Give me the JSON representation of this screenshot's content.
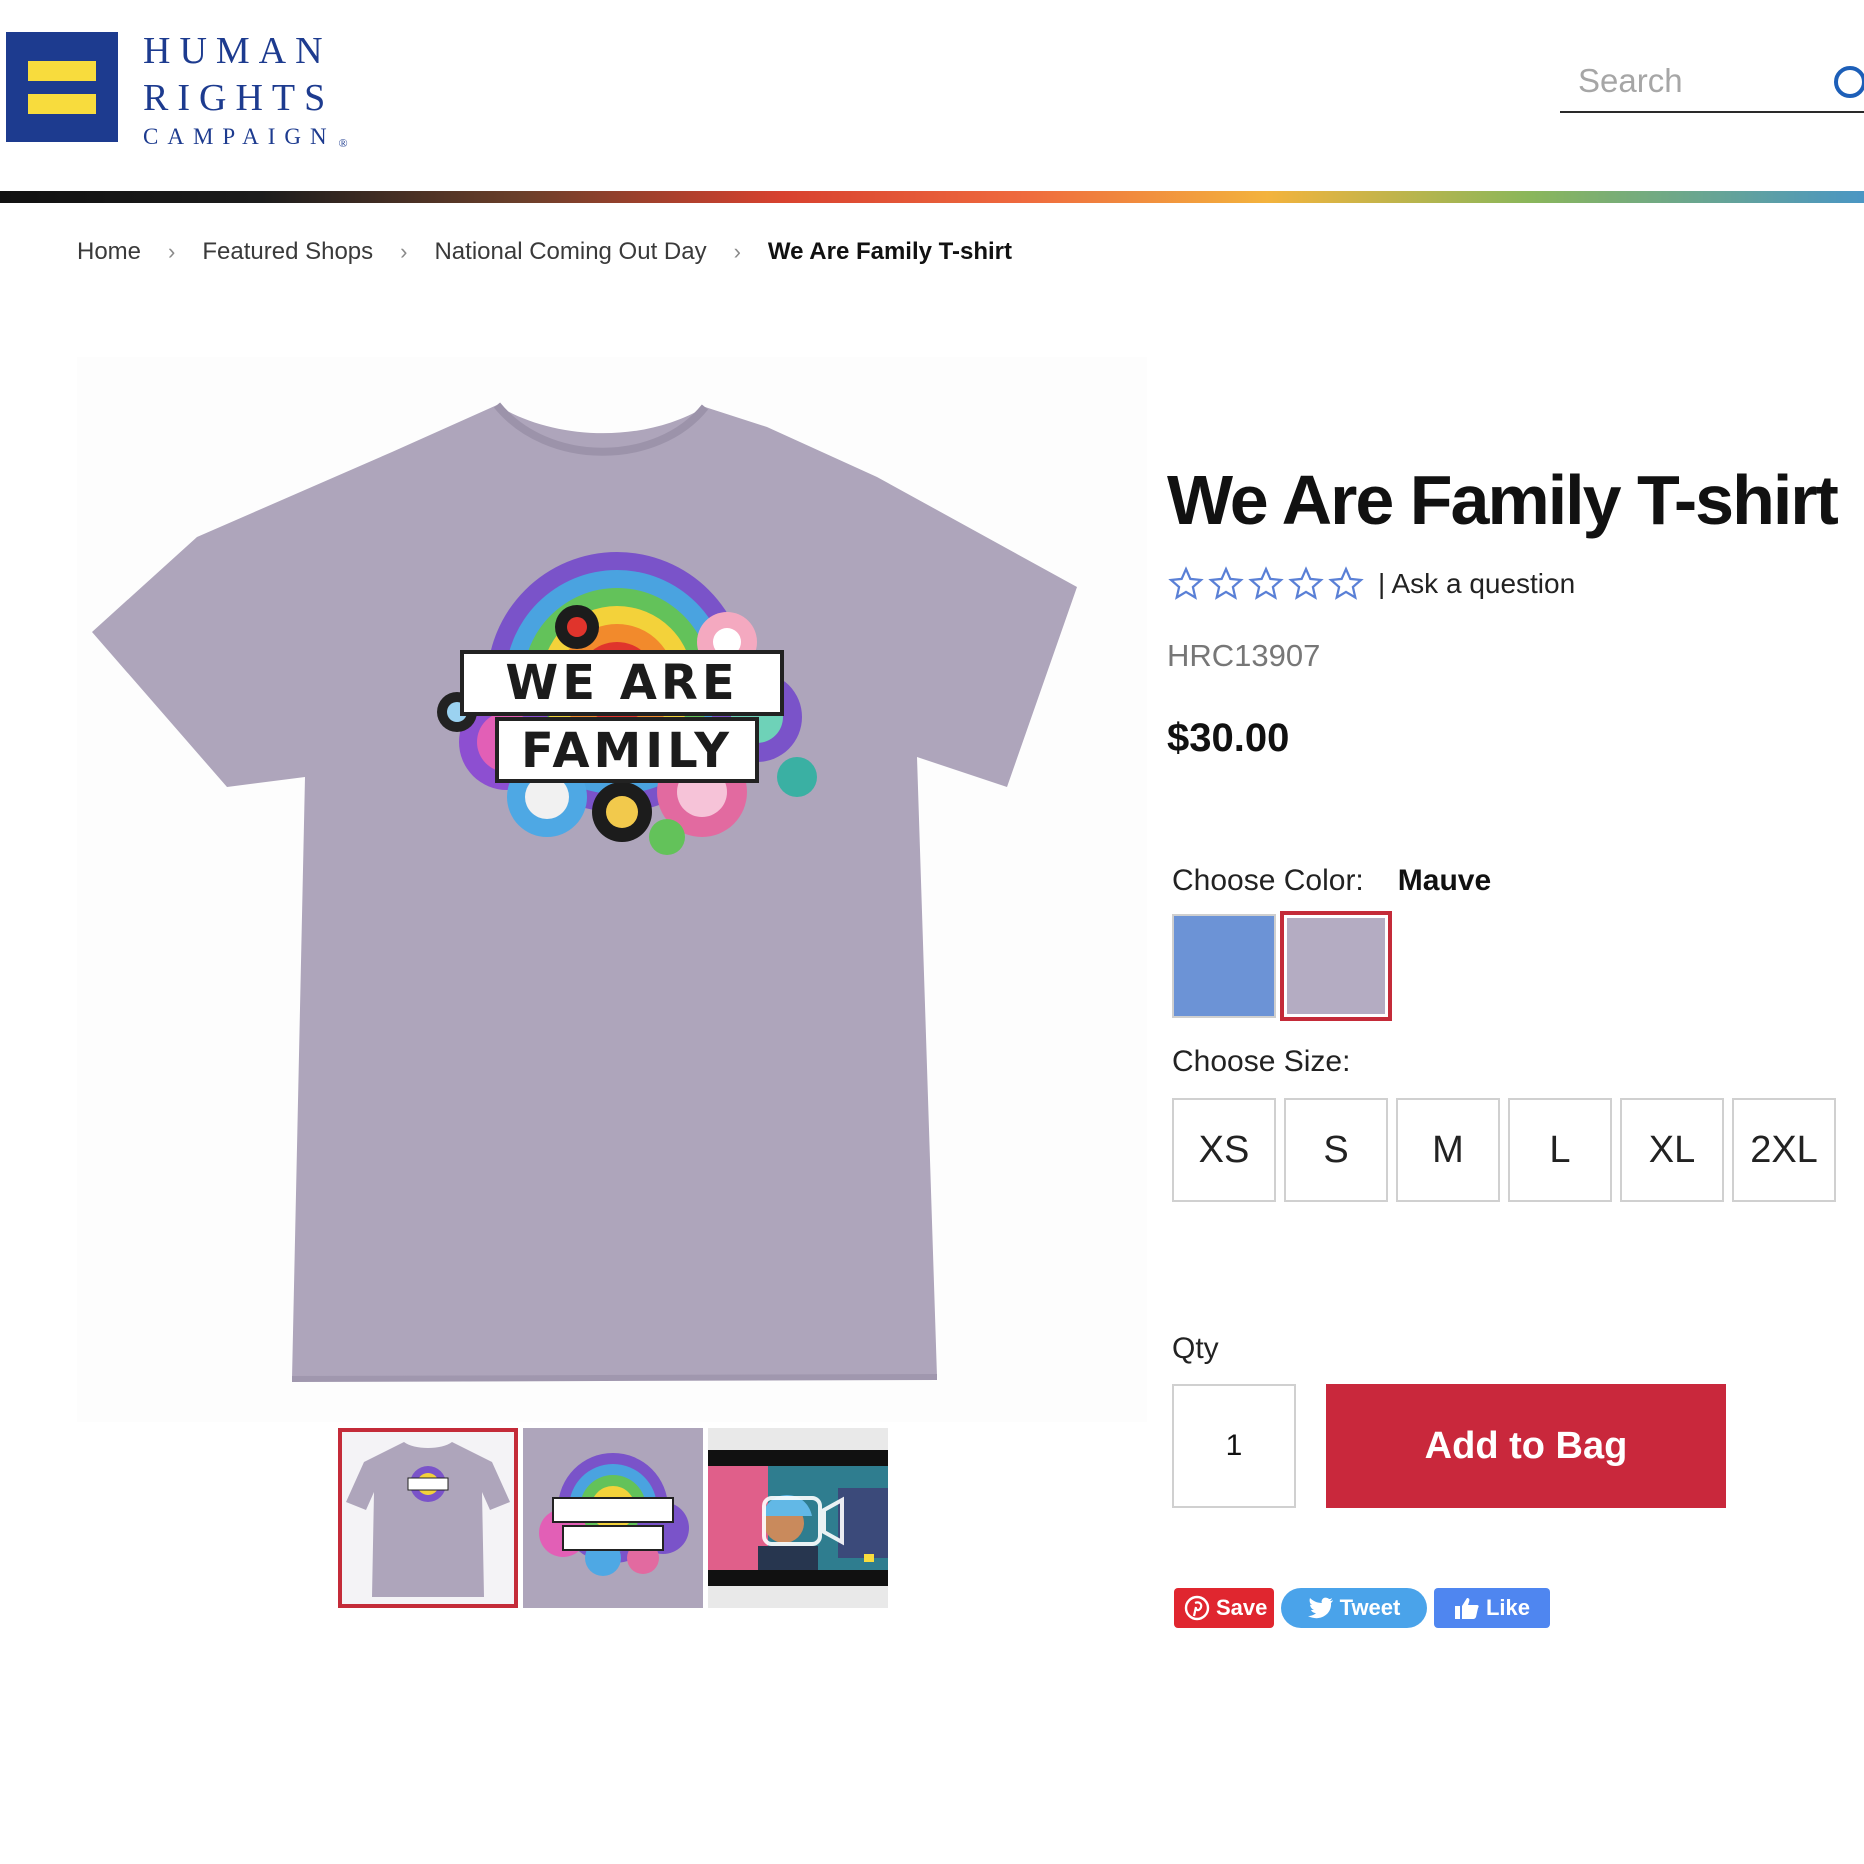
{
  "header": {
    "logo": {
      "line1": "HUMAN",
      "line2": "RIGHTS",
      "line3": "CAMPAIGN",
      "registered": "®"
    },
    "search": {
      "placeholder": "Search"
    }
  },
  "colors": {
    "brand_blue": "#1d3b8f",
    "brand_yellow": "#f8dc3d",
    "accent_red": "#c9283c",
    "shirt_mauve": "#aea5bb",
    "swatch_blue": "#6c93d6"
  },
  "breadcrumb": {
    "items": [
      "Home",
      "Featured Shops",
      "National Coming Out Day"
    ],
    "current": "We Are Family T-shirt"
  },
  "product": {
    "title": "We Are Family T-shirt",
    "rating_stars": 0,
    "ask_question": "| Ask a question",
    "sku": "HRC13907",
    "price": "$30.00",
    "color_label": "Choose Color:",
    "selected_color": "Mauve",
    "colors": [
      "blue",
      "mauve"
    ],
    "size_label": "Choose Size:",
    "sizes": [
      "XS",
      "S",
      "M",
      "L",
      "XL",
      "2XL"
    ],
    "qty_label": "Qty",
    "qty_value": "1",
    "add_to_bag": "Add to Bag",
    "shirt_print": "WE ARE FAMILY"
  },
  "social": {
    "save": "Save",
    "tweet": "Tweet",
    "like": "Like"
  },
  "icons": [
    "search-icon",
    "chevron-right-icon",
    "star-outline-icon",
    "pinterest-icon",
    "twitter-icon",
    "thumbs-up-icon",
    "video-icon"
  ]
}
